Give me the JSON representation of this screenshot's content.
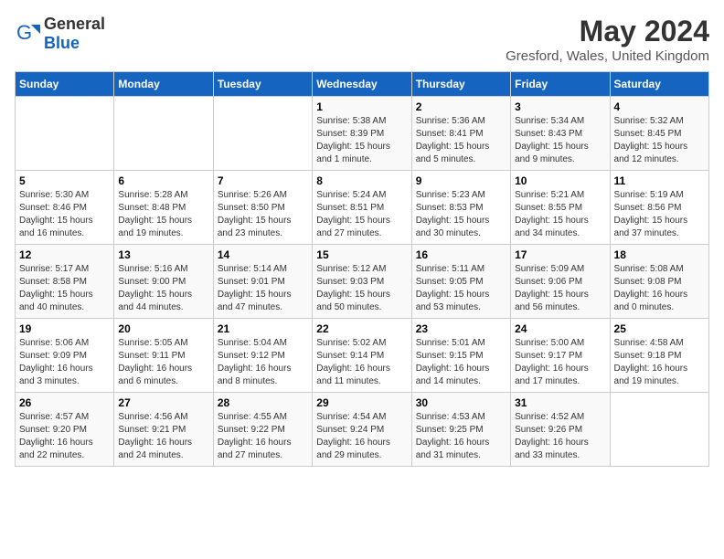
{
  "logo": {
    "text_general": "General",
    "text_blue": "Blue"
  },
  "calendar": {
    "title": "May 2024",
    "subtitle": "Gresford, Wales, United Kingdom",
    "weekdays": [
      "Sunday",
      "Monday",
      "Tuesday",
      "Wednesday",
      "Thursday",
      "Friday",
      "Saturday"
    ],
    "weeks": [
      [
        {
          "day": "",
          "info": ""
        },
        {
          "day": "",
          "info": ""
        },
        {
          "day": "",
          "info": ""
        },
        {
          "day": "1",
          "info": "Sunrise: 5:38 AM\nSunset: 8:39 PM\nDaylight: 15 hours\nand 1 minute."
        },
        {
          "day": "2",
          "info": "Sunrise: 5:36 AM\nSunset: 8:41 PM\nDaylight: 15 hours\nand 5 minutes."
        },
        {
          "day": "3",
          "info": "Sunrise: 5:34 AM\nSunset: 8:43 PM\nDaylight: 15 hours\nand 9 minutes."
        },
        {
          "day": "4",
          "info": "Sunrise: 5:32 AM\nSunset: 8:45 PM\nDaylight: 15 hours\nand 12 minutes."
        }
      ],
      [
        {
          "day": "5",
          "info": "Sunrise: 5:30 AM\nSunset: 8:46 PM\nDaylight: 15 hours\nand 16 minutes."
        },
        {
          "day": "6",
          "info": "Sunrise: 5:28 AM\nSunset: 8:48 PM\nDaylight: 15 hours\nand 19 minutes."
        },
        {
          "day": "7",
          "info": "Sunrise: 5:26 AM\nSunset: 8:50 PM\nDaylight: 15 hours\nand 23 minutes."
        },
        {
          "day": "8",
          "info": "Sunrise: 5:24 AM\nSunset: 8:51 PM\nDaylight: 15 hours\nand 27 minutes."
        },
        {
          "day": "9",
          "info": "Sunrise: 5:23 AM\nSunset: 8:53 PM\nDaylight: 15 hours\nand 30 minutes."
        },
        {
          "day": "10",
          "info": "Sunrise: 5:21 AM\nSunset: 8:55 PM\nDaylight: 15 hours\nand 34 minutes."
        },
        {
          "day": "11",
          "info": "Sunrise: 5:19 AM\nSunset: 8:56 PM\nDaylight: 15 hours\nand 37 minutes."
        }
      ],
      [
        {
          "day": "12",
          "info": "Sunrise: 5:17 AM\nSunset: 8:58 PM\nDaylight: 15 hours\nand 40 minutes."
        },
        {
          "day": "13",
          "info": "Sunrise: 5:16 AM\nSunset: 9:00 PM\nDaylight: 15 hours\nand 44 minutes."
        },
        {
          "day": "14",
          "info": "Sunrise: 5:14 AM\nSunset: 9:01 PM\nDaylight: 15 hours\nand 47 minutes."
        },
        {
          "day": "15",
          "info": "Sunrise: 5:12 AM\nSunset: 9:03 PM\nDaylight: 15 hours\nand 50 minutes."
        },
        {
          "day": "16",
          "info": "Sunrise: 5:11 AM\nSunset: 9:05 PM\nDaylight: 15 hours\nand 53 minutes."
        },
        {
          "day": "17",
          "info": "Sunrise: 5:09 AM\nSunset: 9:06 PM\nDaylight: 15 hours\nand 56 minutes."
        },
        {
          "day": "18",
          "info": "Sunrise: 5:08 AM\nSunset: 9:08 PM\nDaylight: 16 hours\nand 0 minutes."
        }
      ],
      [
        {
          "day": "19",
          "info": "Sunrise: 5:06 AM\nSunset: 9:09 PM\nDaylight: 16 hours\nand 3 minutes."
        },
        {
          "day": "20",
          "info": "Sunrise: 5:05 AM\nSunset: 9:11 PM\nDaylight: 16 hours\nand 6 minutes."
        },
        {
          "day": "21",
          "info": "Sunrise: 5:04 AM\nSunset: 9:12 PM\nDaylight: 16 hours\nand 8 minutes."
        },
        {
          "day": "22",
          "info": "Sunrise: 5:02 AM\nSunset: 9:14 PM\nDaylight: 16 hours\nand 11 minutes."
        },
        {
          "day": "23",
          "info": "Sunrise: 5:01 AM\nSunset: 9:15 PM\nDaylight: 16 hours\nand 14 minutes."
        },
        {
          "day": "24",
          "info": "Sunrise: 5:00 AM\nSunset: 9:17 PM\nDaylight: 16 hours\nand 17 minutes."
        },
        {
          "day": "25",
          "info": "Sunrise: 4:58 AM\nSunset: 9:18 PM\nDaylight: 16 hours\nand 19 minutes."
        }
      ],
      [
        {
          "day": "26",
          "info": "Sunrise: 4:57 AM\nSunset: 9:20 PM\nDaylight: 16 hours\nand 22 minutes."
        },
        {
          "day": "27",
          "info": "Sunrise: 4:56 AM\nSunset: 9:21 PM\nDaylight: 16 hours\nand 24 minutes."
        },
        {
          "day": "28",
          "info": "Sunrise: 4:55 AM\nSunset: 9:22 PM\nDaylight: 16 hours\nand 27 minutes."
        },
        {
          "day": "29",
          "info": "Sunrise: 4:54 AM\nSunset: 9:24 PM\nDaylight: 16 hours\nand 29 minutes."
        },
        {
          "day": "30",
          "info": "Sunrise: 4:53 AM\nSunset: 9:25 PM\nDaylight: 16 hours\nand 31 minutes."
        },
        {
          "day": "31",
          "info": "Sunrise: 4:52 AM\nSunset: 9:26 PM\nDaylight: 16 hours\nand 33 minutes."
        },
        {
          "day": "",
          "info": ""
        }
      ]
    ]
  }
}
